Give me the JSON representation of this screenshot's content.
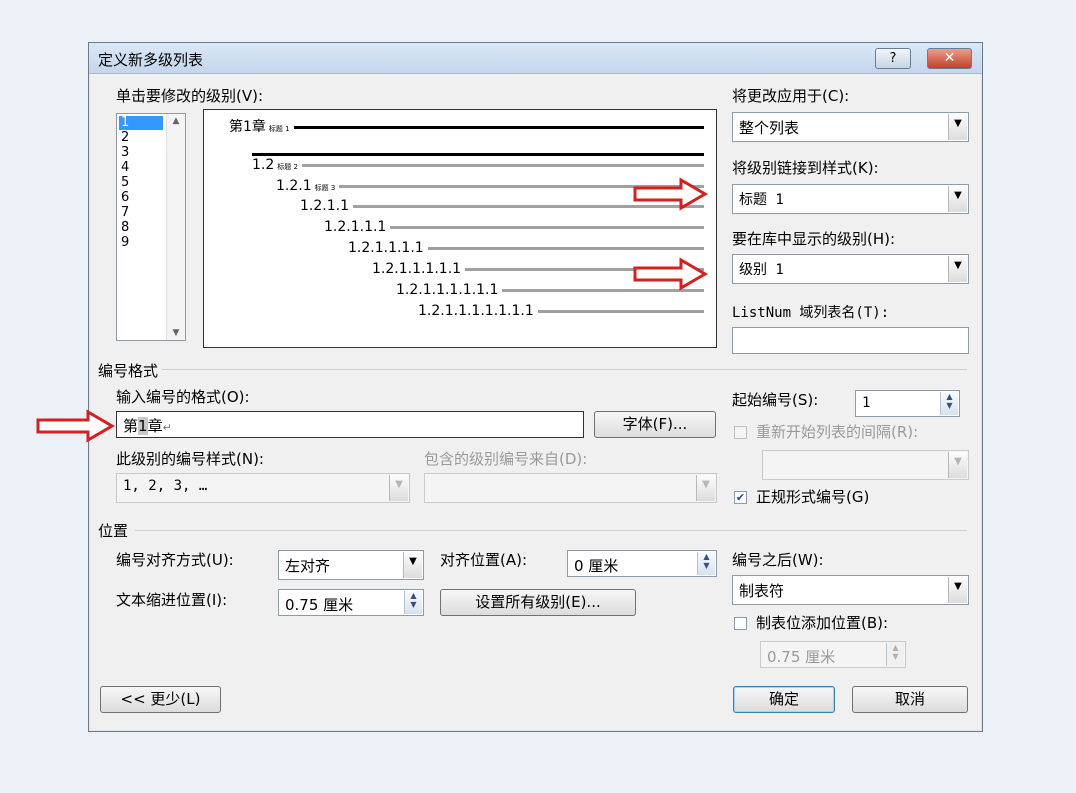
{
  "dialog": {
    "title": "定义新多级列表",
    "help_label": "?",
    "close_label": "✕"
  },
  "levels": {
    "label": "单击要修改的级别(V):",
    "items": [
      "1",
      "2",
      "3",
      "4",
      "5",
      "6",
      "7",
      "8",
      "9"
    ],
    "selected": "1"
  },
  "preview": {
    "lines": [
      {
        "number": "第1章",
        "style": "标题 1"
      },
      {
        "number": "1.2",
        "style": "标题 2"
      },
      {
        "number": "1.2.1",
        "style": "标题 3"
      },
      {
        "number": "1.2.1.1",
        "style": ""
      },
      {
        "number": "1.2.1.1.1",
        "style": ""
      },
      {
        "number": "1.2.1.1.1.1",
        "style": ""
      },
      {
        "number": "1.2.1.1.1.1.1",
        "style": ""
      },
      {
        "number": "1.2.1.1.1.1.1.1",
        "style": ""
      },
      {
        "number": "1.2.1.1.1.1.1.1.1",
        "style": ""
      }
    ]
  },
  "apply_to": {
    "label": "将更改应用于(C):",
    "value": "整个列表"
  },
  "link_style": {
    "label": "将级别链接到样式(K):",
    "value": "标题 1"
  },
  "gallery_level": {
    "label": "要在库中显示的级别(H):",
    "value": "级别 1"
  },
  "listnum": {
    "label": "ListNum 域列表名(T):",
    "value": ""
  },
  "number_format": {
    "section_label": "编号格式",
    "format_label": "输入编号的格式(O):",
    "format_value_prefix": "第",
    "format_value_num": "1",
    "format_value_suffix": "章",
    "font_button": "字体(F)...",
    "style_label": "此级别的编号样式(N):",
    "style_value": "1, 2, 3, …",
    "include_label": "包含的级别编号来自(D):",
    "include_value": ""
  },
  "start_at": {
    "label": "起始编号(S):",
    "value": "1"
  },
  "restart": {
    "label": "重新开始列表的间隔(R):",
    "checked": false,
    "value": ""
  },
  "legal": {
    "label": "正规形式编号(G)",
    "checked": true
  },
  "position": {
    "section_label": "位置",
    "align_label": "编号对齐方式(U):",
    "align_value": "左对齐",
    "at_label": "对齐位置(A):",
    "at_value": "0 厘米",
    "indent_label": "文本缩进位置(I):",
    "indent_value": "0.75 厘米",
    "set_all_button": "设置所有级别(E)..."
  },
  "follow": {
    "label": "编号之后(W):",
    "value": "制表符"
  },
  "tab_stop": {
    "label": "制表位添加位置(B):",
    "checked": false,
    "value": "0.75 厘米"
  },
  "buttons": {
    "less": "<< 更少(L)",
    "ok": "确定",
    "cancel": "取消"
  },
  "colors": {
    "arrow": "#d42020",
    "selection": "#3399ff"
  }
}
